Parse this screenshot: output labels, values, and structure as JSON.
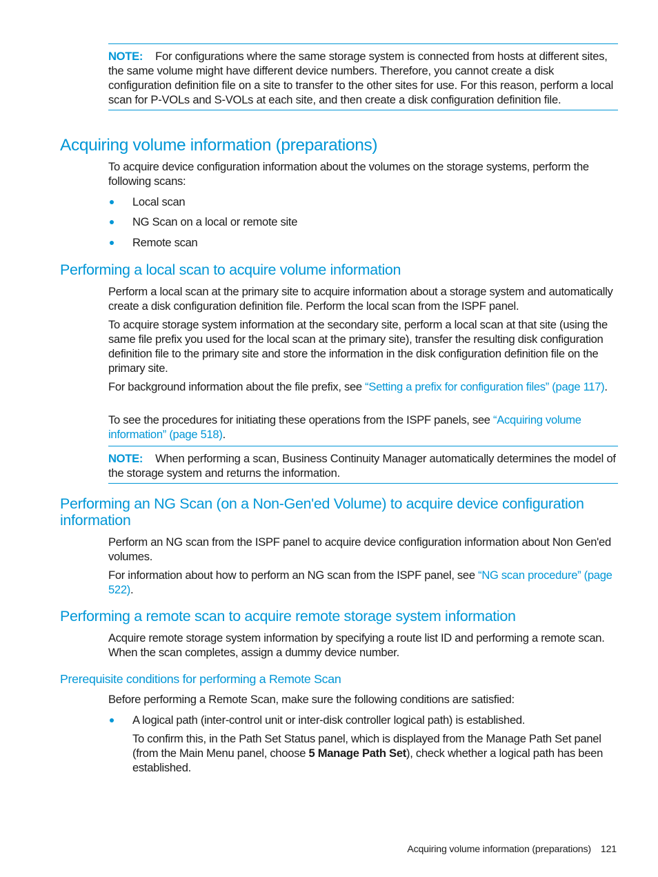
{
  "note_1": {
    "label": "NOTE:",
    "text": "For configurations where the same storage system is connected from hosts at different sites, the same volume might have different device numbers. Therefore, you cannot create a disk configuration definition file on a site to transfer to the other sites for use. For this reason, perform a local scan for P-VOLs and S-VOLs at each site, and then create a disk configuration definition file."
  },
  "section_main": {
    "heading": "Acquiring volume information (preparations)",
    "intro": "To acquire device configuration information about the volumes on the storage systems, perform the following scans:",
    "bullets": [
      "Local scan",
      "NG Scan on a local or remote site",
      "Remote scan"
    ]
  },
  "section_local": {
    "heading": "Performing a local scan to acquire volume information",
    "para_1": "Perform a local scan at the primary site to acquire information about a storage system and automatically create a disk configuration definition file. Perform the local scan from the ISPF panel.",
    "para_2": "To acquire storage system information at the secondary site, perform a local scan at that site (using the same file prefix you used for the local scan at the primary site), transfer the resulting disk configuration definition file to the primary site and store the information in the disk configuration definition file on the primary site.",
    "para_3_prefix": "For background information about the file prefix, see ",
    "para_3_link": "“Setting a prefix for configuration files” (page 117)",
    "para_3_suffix": ".",
    "para_4_prefix": "To see the procedures for initiating these operations from the ISPF panels, see ",
    "para_4_link": "“Acquiring volume information” (page 518)",
    "para_4_suffix": ".",
    "note": {
      "label": "NOTE:",
      "text": "When performing a scan, Business Continuity Manager automatically determines the model of the storage system and returns the information."
    }
  },
  "section_ng": {
    "heading": "Performing an NG Scan (on a Non-Gen'ed Volume) to acquire device configuration information",
    "para_1": "Perform an NG scan from the ISPF panel to acquire device configuration information about Non Gen'ed volumes.",
    "para_2_prefix": "For information about how to perform an NG scan from the ISPF panel, see ",
    "para_2_link": "“NG scan procedure” (page 522)",
    "para_2_suffix": "."
  },
  "section_remote": {
    "heading": "Performing a remote scan to acquire remote storage system information",
    "para_1": "Acquire remote storage system information by specifying a route list ID and performing a remote scan. When the scan completes, assign a dummy device number."
  },
  "section_prereq": {
    "heading": "Prerequisite conditions for performing a Remote Scan",
    "intro": "Before performing a Remote Scan, make sure the following conditions are satisfied:",
    "bullet_1": "A logical path (inter-control unit or inter-disk controller logical path) is established.",
    "detail_prefix": "To confirm this, in the Path Set Status panel, which is displayed from the Manage Path Set panel (from the Main Menu panel, choose ",
    "detail_bold": "5 Manage Path Set",
    "detail_suffix": "), check whether a logical path has been established."
  },
  "footer": {
    "section_title": "Acquiring volume information (preparations)",
    "page_number": "121"
  },
  "colors": {
    "accent": "#0096d6",
    "text": "#1a1a1a"
  }
}
